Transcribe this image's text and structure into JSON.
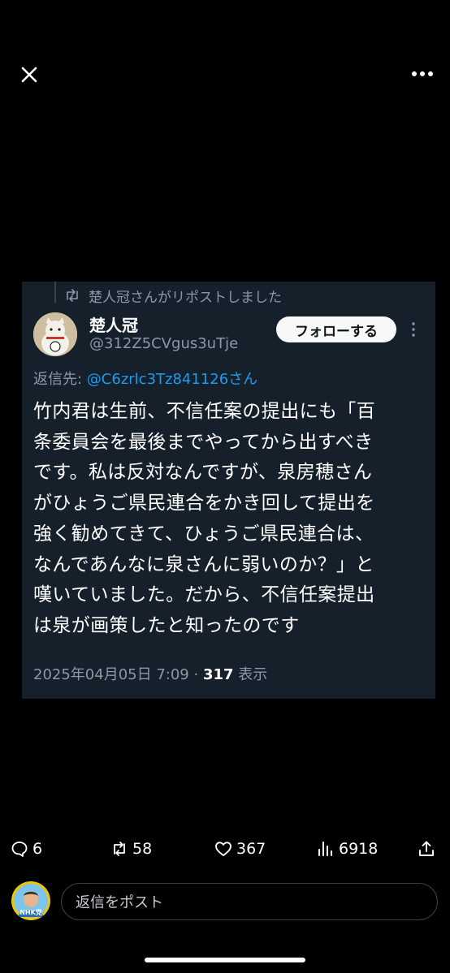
{
  "viewer": {
    "close_icon": "close-icon",
    "more_icon": "more-horizontal-icon"
  },
  "tweet_image": {
    "repost_text": "楚人冠さんがリポストしました",
    "author_name": "楚人冠",
    "author_handle": "@312Z5CVgus3uTje",
    "follow_label": "フォローする",
    "reply_prefix": "返信先: ",
    "reply_to": "@C6zrlc3Tz841126さん",
    "body": "竹内君は生前、不信任案の提出にも「百\n条委員会を最後までやってから出すべき\nです。私は反対なんですが、泉房穂さん\nがひょうご県民連合をかき回して提出を\n強く勧めてきて、ひょうご県民連合は、\nなんであんなに泉さんに弱いのか？」と\n嘆いていました。だから、不信任案提出\nは泉が画策したと知ったのです",
    "date": "2025年04月05日 7:09 · ",
    "views_count": "317",
    "views_label": " 表示",
    "bg_color": "#15202b"
  },
  "actions": {
    "replies": "6",
    "reposts": "58",
    "likes": "367",
    "views": "6918"
  },
  "reply_bar": {
    "placeholder": "返信をポスト",
    "avatar_text": "NHK党"
  }
}
